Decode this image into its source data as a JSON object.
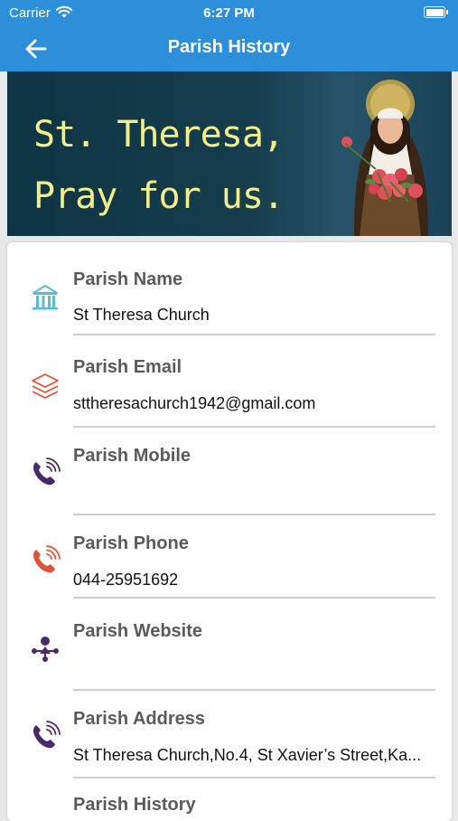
{
  "status_bar": {
    "carrier": "Carrier",
    "time": "6:27 PM",
    "icons": [
      "wifi-icon",
      "battery-icon"
    ]
  },
  "nav": {
    "title": "Parish History",
    "back_icon": "arrow-left-icon"
  },
  "banner": {
    "line1": "St. Theresa,",
    "line2": "Pray for us."
  },
  "parish_info": [
    {
      "label": "Parish Name",
      "value": "St Theresa Church",
      "icon": "building-icon",
      "icon_color": "#5bbad5"
    },
    {
      "label": "Parish Email",
      "value": "sttheresachurch1942@gmail.com",
      "icon": "layers-icon",
      "icon_color": "#e0533a"
    },
    {
      "label": "Parish Mobile",
      "value": "",
      "icon": "phone-icon",
      "icon_color": "#4a2a6e"
    },
    {
      "label": "Parish Phone",
      "value": "044-25951692",
      "icon": "phone-icon",
      "icon_color": "#e0533a"
    },
    {
      "label": "Parish Website",
      "value": "",
      "icon": "network-icon",
      "icon_color": "#4a2a6e"
    },
    {
      "label": "Parish Address",
      "value": "St Theresa Church,No.4, St Xavier’s Street,Ka...",
      "icon": "phone-icon",
      "icon_color": "#4a2a6e"
    },
    {
      "label": "Parish History",
      "value": "",
      "icon": "",
      "icon_color": ""
    }
  ],
  "colors": {
    "header": "#2d8fd9",
    "banner_text": "#f2ef8a",
    "background": "#e8e8e8"
  }
}
